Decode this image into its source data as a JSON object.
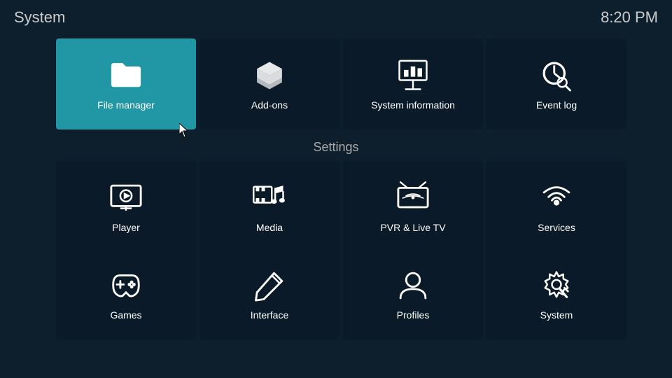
{
  "header": {
    "title": "System",
    "time": "8:20 PM"
  },
  "top_tiles": [
    {
      "id": "file-manager",
      "label": "File manager",
      "active": true
    },
    {
      "id": "add-ons",
      "label": "Add-ons",
      "active": false
    },
    {
      "id": "system-information",
      "label": "System information",
      "active": false
    },
    {
      "id": "event-log",
      "label": "Event log",
      "active": false
    }
  ],
  "settings_label": "Settings",
  "settings_tiles": [
    {
      "id": "player",
      "label": "Player"
    },
    {
      "id": "media",
      "label": "Media"
    },
    {
      "id": "pvr-live-tv",
      "label": "PVR & Live TV"
    },
    {
      "id": "services",
      "label": "Services"
    },
    {
      "id": "games",
      "label": "Games"
    },
    {
      "id": "interface",
      "label": "Interface"
    },
    {
      "id": "profiles",
      "label": "Profiles"
    },
    {
      "id": "system",
      "label": "System"
    }
  ]
}
